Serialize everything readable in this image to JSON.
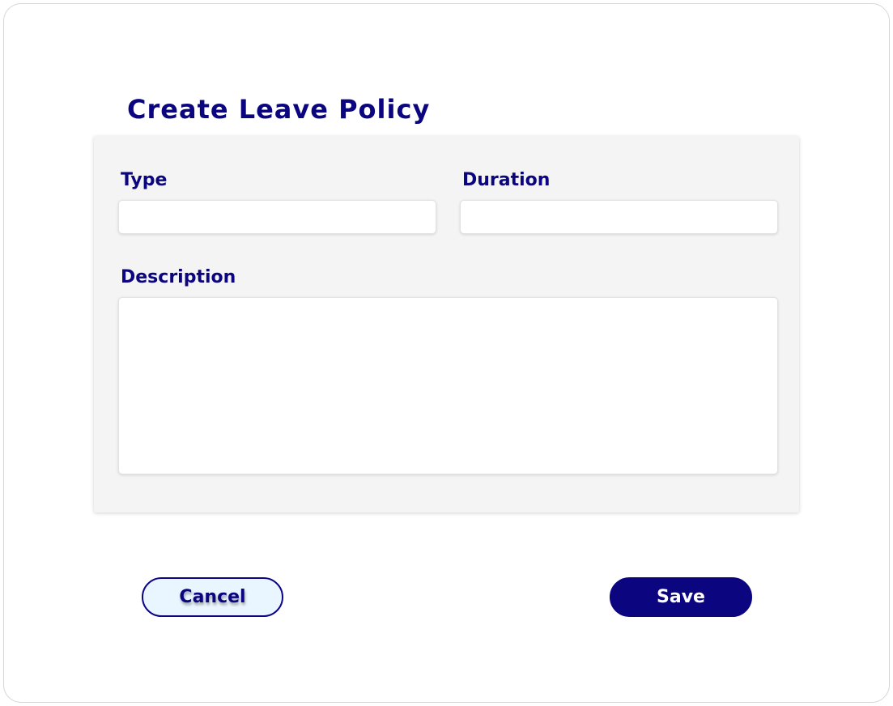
{
  "title": "Create Leave Policy",
  "form": {
    "type": {
      "label": "Type",
      "value": "",
      "placeholder": ""
    },
    "duration": {
      "label": "Duration",
      "value": "",
      "placeholder": ""
    },
    "description": {
      "label": "Description",
      "value": "",
      "placeholder": ""
    }
  },
  "actions": {
    "cancel_label": "Cancel",
    "save_label": "Save"
  },
  "colors": {
    "primary": "#0b0580",
    "card_background": "#f4f4f4",
    "cancel_background": "#eaf6ff"
  }
}
